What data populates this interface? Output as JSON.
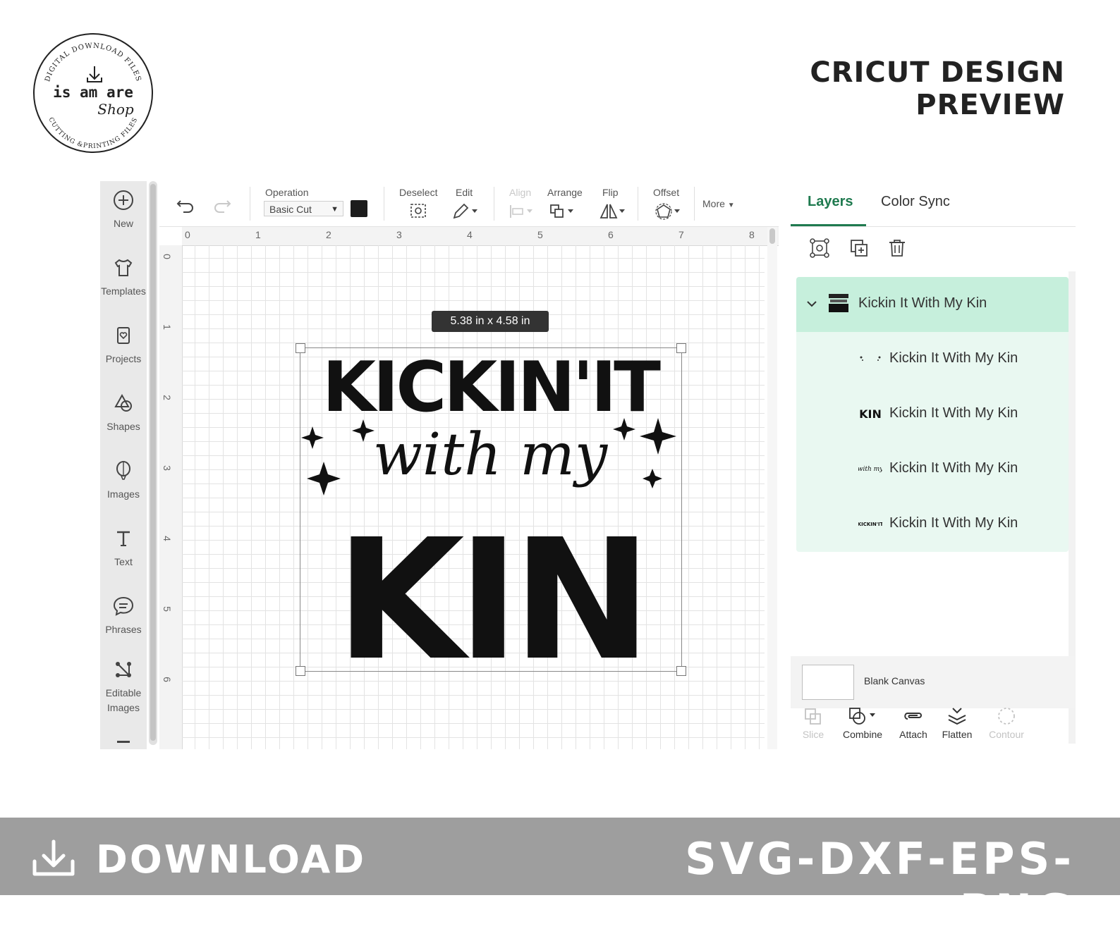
{
  "header": {
    "title": "CRICUT DESIGN PREVIEW"
  },
  "logo": {
    "top_arc": "DIGITAL DOWNLOAD FILES",
    "bottom_arc": "CUTTING &PRINTING FILES",
    "brand": "is am are",
    "script": "Shop"
  },
  "sidebar": {
    "items": [
      {
        "label": "New",
        "icon": "plus-circle-icon"
      },
      {
        "label": "Templates",
        "icon": "tshirt-icon"
      },
      {
        "label": "Projects",
        "icon": "projects-icon"
      },
      {
        "label": "Shapes",
        "icon": "shapes-icon"
      },
      {
        "label": "Images",
        "icon": "balloon-icon"
      },
      {
        "label": "Text",
        "icon": "text-icon"
      },
      {
        "label": "Phrases",
        "icon": "speech-bubble-icon"
      },
      {
        "label": "Editable\nImages",
        "icon": "editable-images-icon"
      }
    ]
  },
  "toolbar": {
    "operation_label": "Operation",
    "operation_value": "Basic Cut",
    "operation_color": "#1c1c1c",
    "deselect_label": "Deselect",
    "edit_label": "Edit",
    "align_label": "Align",
    "arrange_label": "Arrange",
    "flip_label": "Flip",
    "offset_label": "Offset",
    "more_label": "More"
  },
  "canvas": {
    "ruler_top": [
      "0",
      "1",
      "2",
      "3",
      "4",
      "5",
      "6",
      "7",
      "8"
    ],
    "ruler_left": [
      "0",
      "1",
      "2",
      "3",
      "4",
      "5",
      "6"
    ],
    "size_badge": "5.38  in x 4.58  in",
    "design_line1": "KICKIN'IT",
    "design_line2": "with my",
    "design_line3": "KIN"
  },
  "panel": {
    "tab_layers": "Layers",
    "tab_color_sync": "Color Sync",
    "group_name": "Kickin It With My Kin",
    "layers": [
      {
        "name": "Kickin It With My Kin",
        "thumb": "sparkles"
      },
      {
        "name": "Kickin It With My Kin",
        "thumb": "KIN"
      },
      {
        "name": "Kickin It With My Kin",
        "thumb": "with my"
      },
      {
        "name": "Kickin It With My Kin",
        "thumb": "KICKIN'IT"
      }
    ],
    "blank_canvas": "Blank Canvas",
    "tools": {
      "slice": "Slice",
      "combine": "Combine",
      "attach": "Attach",
      "flatten": "Flatten",
      "contour": "Contour"
    }
  },
  "footer": {
    "download": "DOWNLOAD",
    "formats": "SVG-DXF-EPS-PNG"
  },
  "colors": {
    "accent_green": "#1f7a4f",
    "layer_highlight": "#c6efdc",
    "layer_bg": "#e9f8f1",
    "footer_bg": "#9e9e9e"
  }
}
